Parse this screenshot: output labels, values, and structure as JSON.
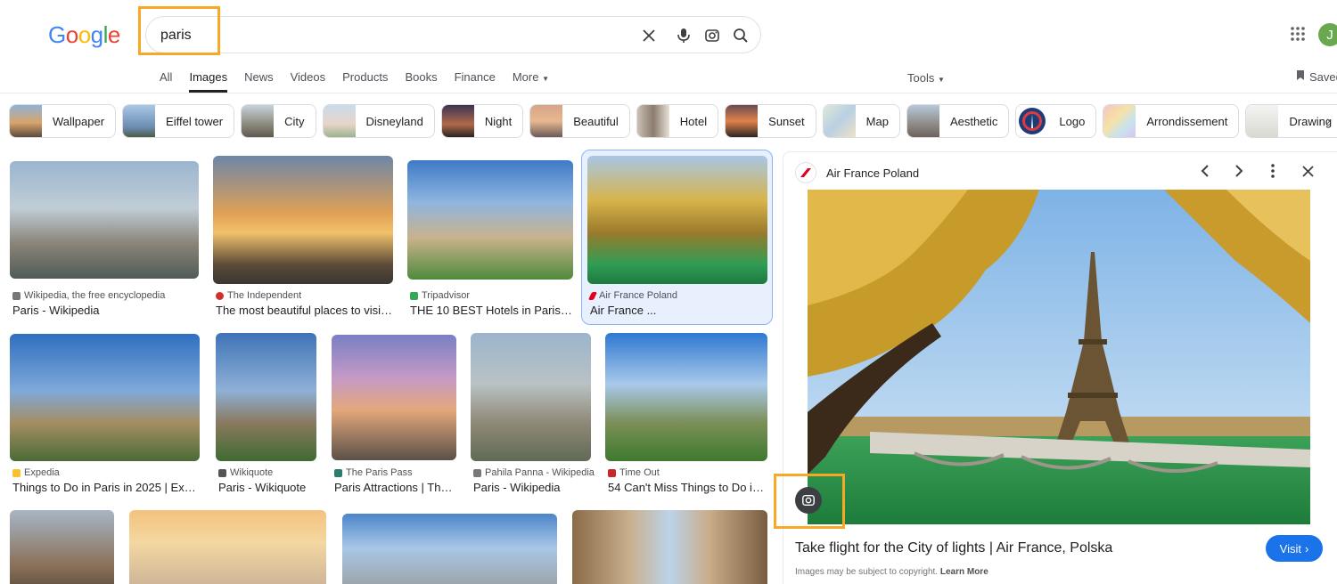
{
  "logo": "Google",
  "search": {
    "value": "paris"
  },
  "user": {
    "initial": "J"
  },
  "tabs": [
    {
      "label": "All",
      "active": false
    },
    {
      "label": "Images",
      "active": true
    },
    {
      "label": "News",
      "active": false
    },
    {
      "label": "Videos",
      "active": false
    },
    {
      "label": "Products",
      "active": false
    },
    {
      "label": "Books",
      "active": false
    },
    {
      "label": "Finance",
      "active": false
    },
    {
      "label": "More",
      "active": false
    }
  ],
  "tools_label": "Tools",
  "saved_label": "Saved",
  "chips": [
    {
      "label": "Wallpaper"
    },
    {
      "label": "Eiffel tower"
    },
    {
      "label": "City"
    },
    {
      "label": "Disneyland"
    },
    {
      "label": "Night"
    },
    {
      "label": "Beautiful"
    },
    {
      "label": "Hotel"
    },
    {
      "label": "Sunset"
    },
    {
      "label": "Map"
    },
    {
      "label": "Aesthetic"
    },
    {
      "label": "Logo"
    },
    {
      "label": "Arrondissement"
    },
    {
      "label": "Drawing"
    }
  ],
  "results": [
    {
      "source": "Wikipedia, the free encyclopedia",
      "title": "Paris - Wikipedia"
    },
    {
      "source": "The Independent",
      "title": "The most beautiful places to visit in ..."
    },
    {
      "source": "Tripadvisor",
      "title": "THE 10 BEST Hotels in Paris 20..."
    },
    {
      "source": "Air France Poland",
      "title": "Air France ..."
    },
    {
      "source": "Expedia",
      "title": "Things to Do in Paris in 2025 | Expedia"
    },
    {
      "source": "Wikiquote",
      "title": "Paris - Wikiquote"
    },
    {
      "source": "The Paris Pass",
      "title": "Paris Attractions | The ..."
    },
    {
      "source": "Pahila Panna - Wikipedia",
      "title": "Paris - Wikipedia"
    },
    {
      "source": "Time Out",
      "title": "54 Can't Miss Things to Do in P..."
    }
  ],
  "panel": {
    "source": "Air France Poland",
    "title": "Take flight for the City of lights | Air France, Polska",
    "visit_label": "Visit",
    "copyright_text": "Images may be subject to copyright.",
    "learn_more": "Learn More"
  }
}
